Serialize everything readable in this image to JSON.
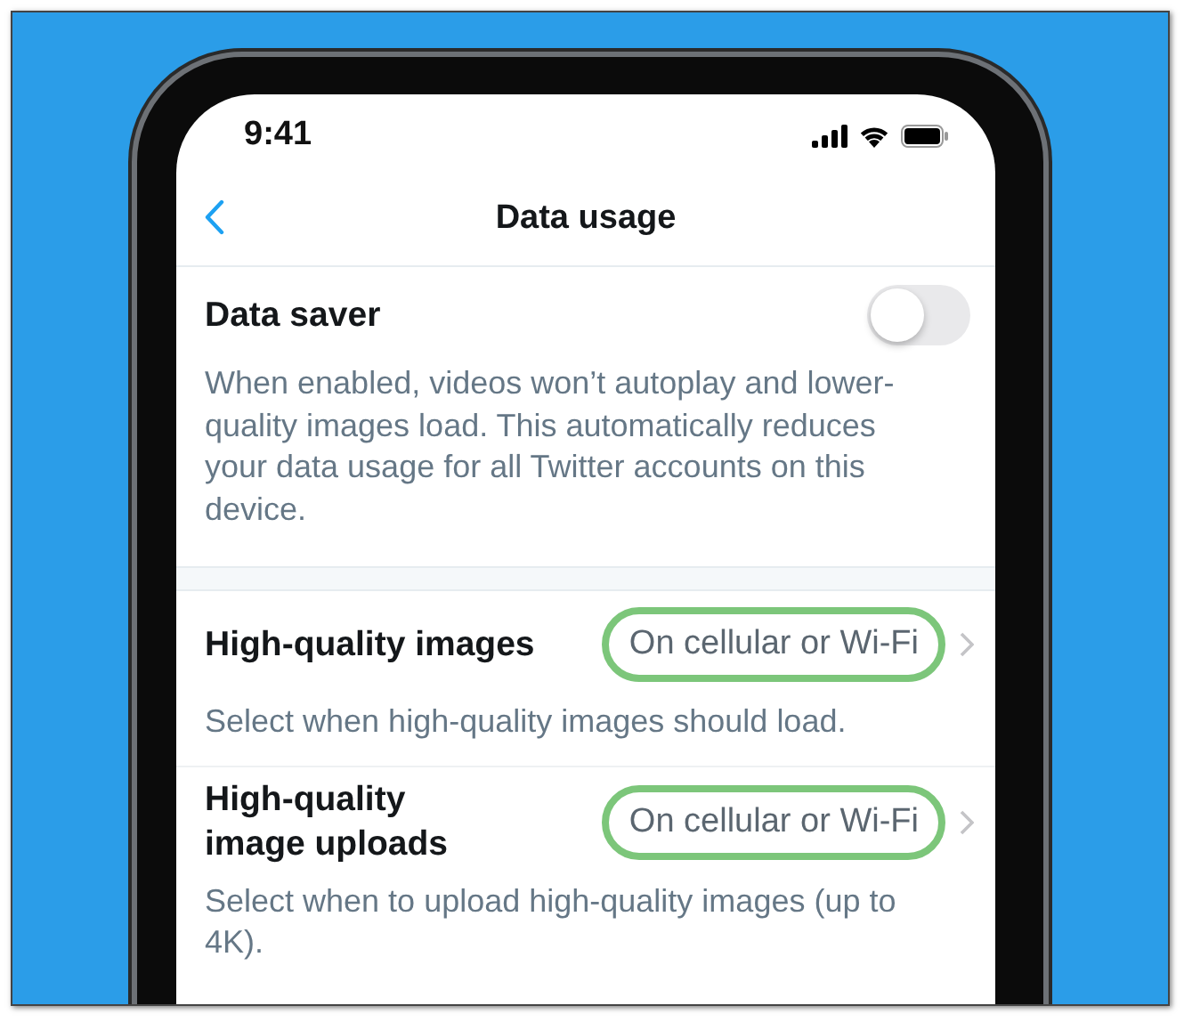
{
  "status_bar": {
    "time": "9:41"
  },
  "nav": {
    "title": "Data usage"
  },
  "data_saver": {
    "label": "Data saver",
    "on": false,
    "description": "When enabled, videos won’t autoplay and lower-quality images load. This automatically reduces your data usage for all Twitter accounts on this device."
  },
  "settings": [
    {
      "label": "High-quality images",
      "value": "On cellular or Wi-Fi",
      "highlighted": true,
      "description": "Select when high-quality images should load."
    },
    {
      "label": "High-quality image uploads",
      "value": "On cellular or Wi-Fi",
      "highlighted": true,
      "description": "Select when to upload high-quality images (up to 4K)."
    }
  ]
}
